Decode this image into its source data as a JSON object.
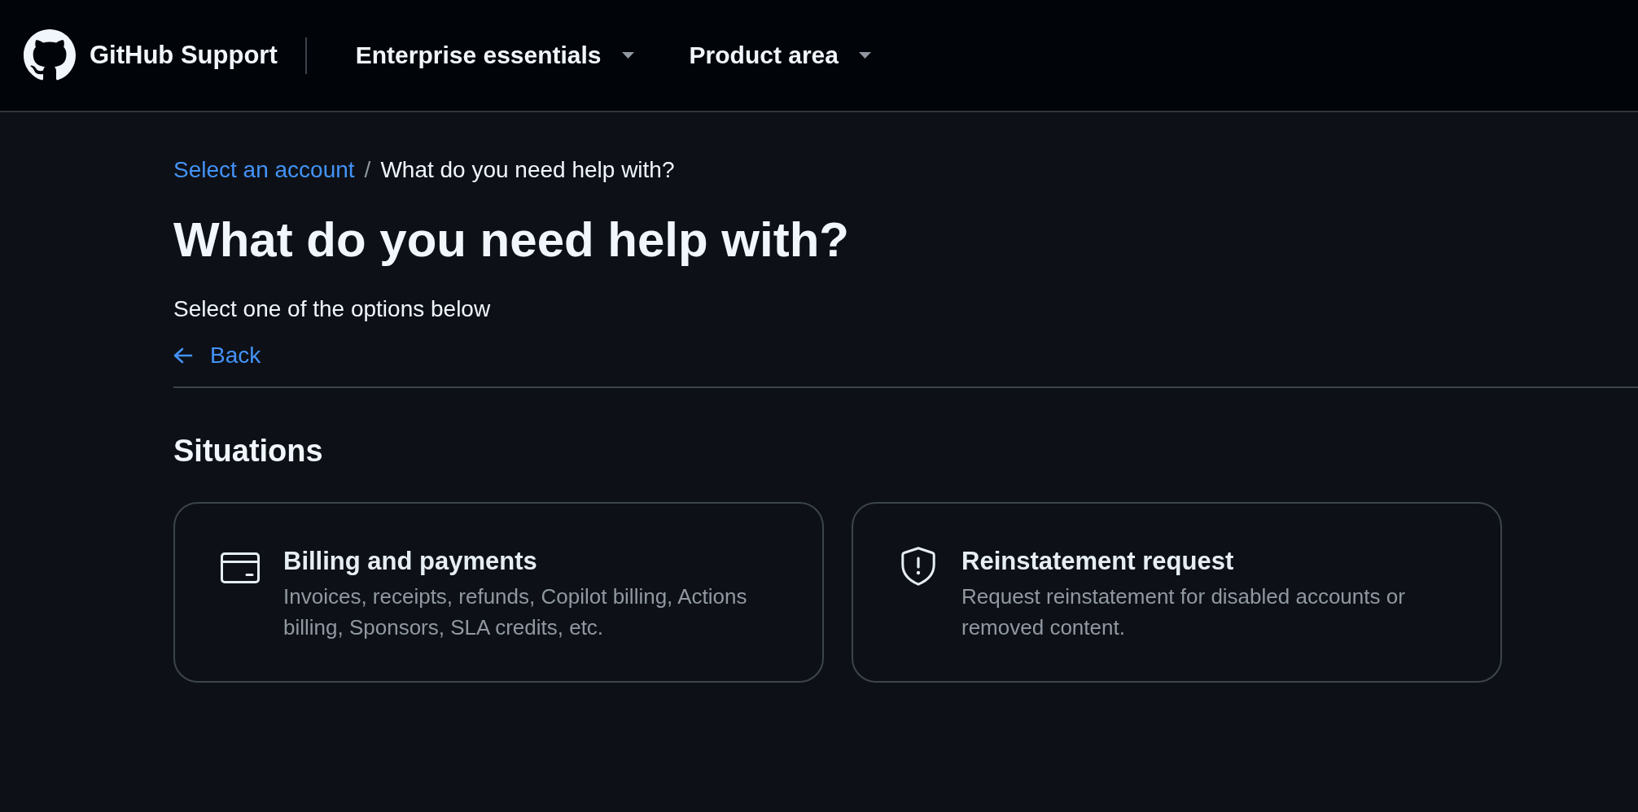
{
  "header": {
    "title": "GitHub Support",
    "menus": [
      {
        "label": "Enterprise essentials"
      },
      {
        "label": "Product area"
      }
    ]
  },
  "breadcrumb": {
    "separator": "/",
    "items": [
      {
        "label": "Select an account",
        "kind": "link"
      },
      {
        "label": "What do you need help with?",
        "kind": "current"
      }
    ]
  },
  "page_title": "What do you need help with?",
  "subtitle": "Select one of the options below",
  "back_link": {
    "label": "Back"
  },
  "section": {
    "title": "Situations",
    "cards": [
      {
        "kind": "billing",
        "title": "Billing and payments",
        "description": "Invoices, receipts, refunds, Copilot billing, Actions billing, Sponsors, SLA credits, etc."
      },
      {
        "kind": "reinstatement",
        "title": "Reinstatement request",
        "description": "Request reinstatement for disabled accounts or removed content."
      }
    ]
  }
}
